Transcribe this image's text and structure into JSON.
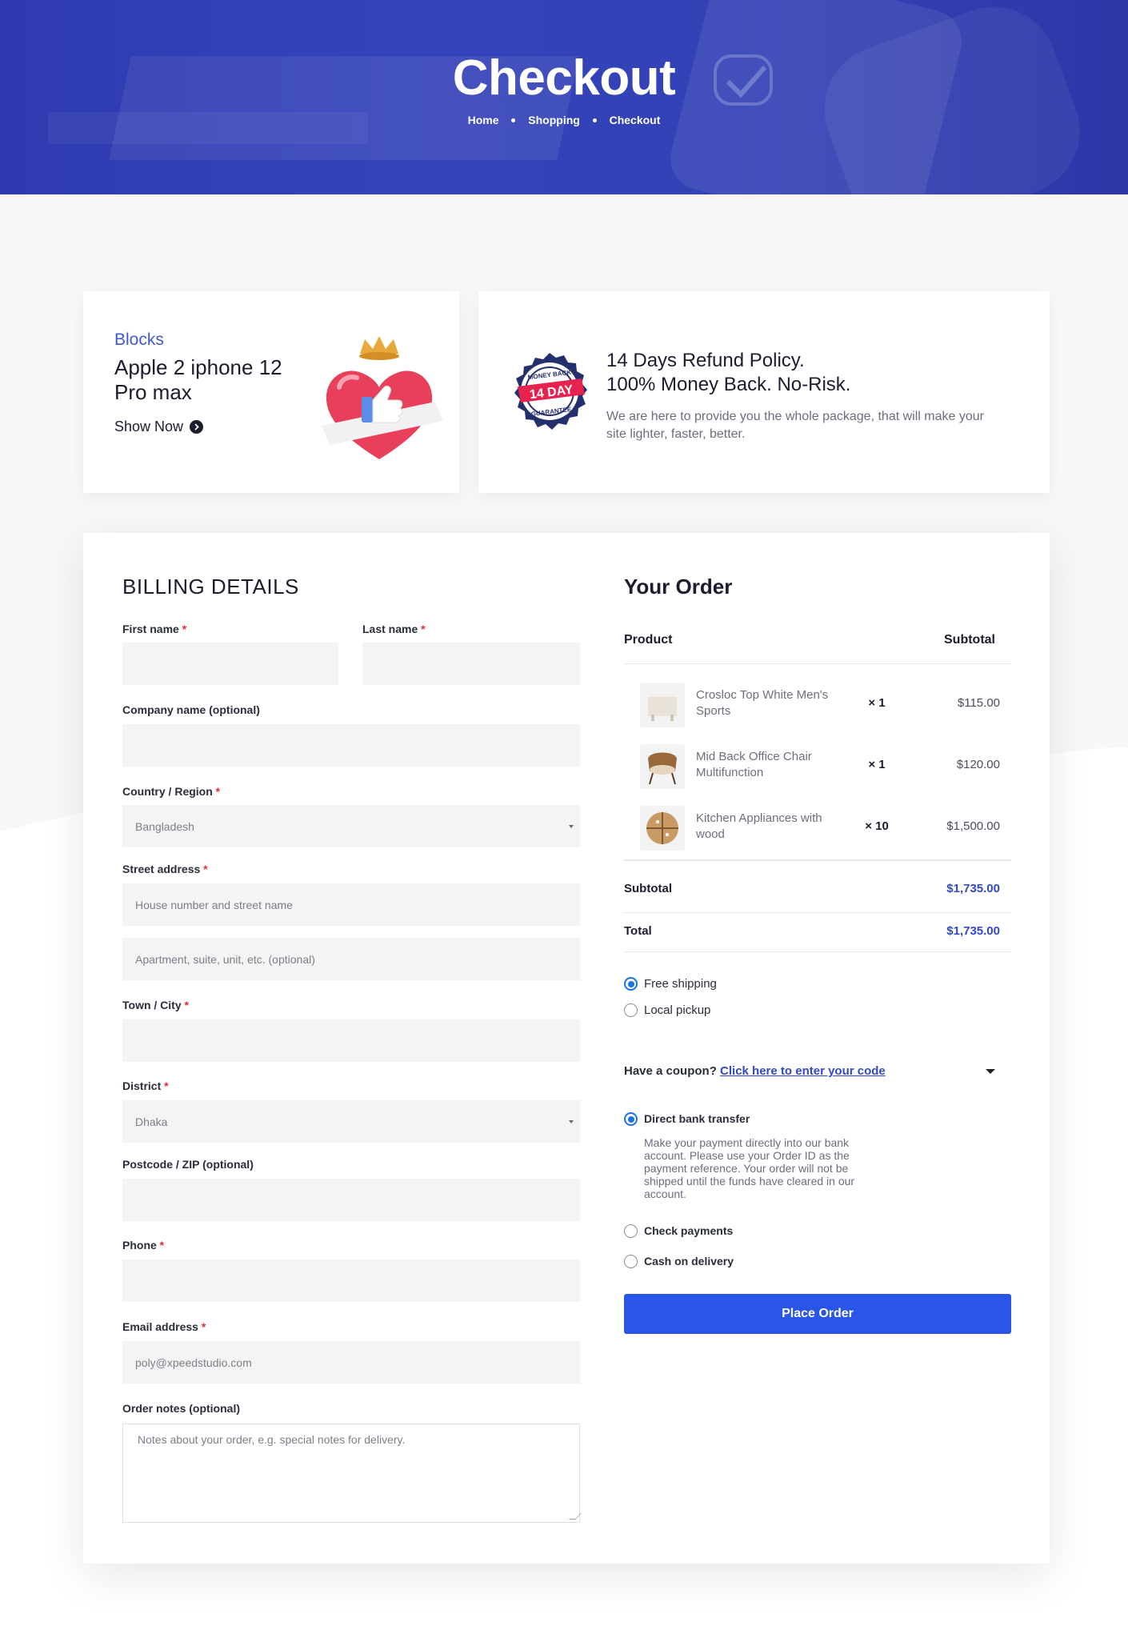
{
  "hero": {
    "title": "Checkout",
    "breadcrumb": [
      "Home",
      "Shopping",
      "Checkout"
    ]
  },
  "promo": {
    "category": "Blocks",
    "title": "Apple 2 iphone 12 Pro max",
    "link": "Show Now"
  },
  "refund": {
    "badge_top": "MONEY BACK",
    "badge_mid": "14 DAY",
    "badge_bottom": "GUARANTEE",
    "title_line1": "14 Days Refund Policy.",
    "title_line2": "100% Money Back. No-Risk.",
    "description": "We are here to provide you the whole package, that will make your site lighter, faster, better."
  },
  "billing": {
    "heading": "BILLING DETAILS",
    "required_mark": "*",
    "first_name": "First name",
    "last_name": "Last name",
    "company": "Company name (optional)",
    "country": "Country / Region",
    "country_value": "Bangladesh",
    "street": "Street address",
    "street_placeholder": "House number and street name",
    "apt_placeholder": "Apartment, suite, unit, etc. (optional)",
    "city": "Town / City",
    "district": "District",
    "district_value": "Dhaka",
    "postcode": "Postcode / ZIP (optional)",
    "phone": "Phone",
    "email": "Email address",
    "email_value": "poly@xpeedstudio.com",
    "notes": "Order notes (optional)",
    "notes_placeholder": "Notes about your order, e.g. special notes for delivery."
  },
  "order": {
    "heading": "Your Order",
    "col_product": "Product",
    "col_subtotal": "Subtotal",
    "items": [
      {
        "name": "Crosloc Top White Men's Sports",
        "qty": "× 1",
        "price": "$115.00"
      },
      {
        "name": "Mid Back Office Chair Multifunction",
        "qty": "× 1",
        "price": "$120.00"
      },
      {
        "name": "Kitchen Appliances with wood",
        "qty": "× 10",
        "price": "$1,500.00"
      }
    ],
    "subtotal_label": "Subtotal",
    "subtotal_value": "$1,735.00",
    "total_label": "Total",
    "total_value": "$1,735.00",
    "shipping": [
      "Free shipping",
      "Local pickup"
    ],
    "coupon_text": "Have a coupon?",
    "coupon_link": "Click here to enter your code",
    "payments": [
      "Direct bank transfer",
      "Check payments",
      "Cash on delivery"
    ],
    "bank_desc": "Make your payment directly into our bank account. Please use your Order ID as the payment reference. Your order will not be shipped until the funds have cleared in our account.",
    "place_order": "Place Order"
  },
  "colors": {
    "hero_bg": "#3441b6",
    "accent": "#2a56e8",
    "link": "#3148c8",
    "required": "#e02b38"
  }
}
